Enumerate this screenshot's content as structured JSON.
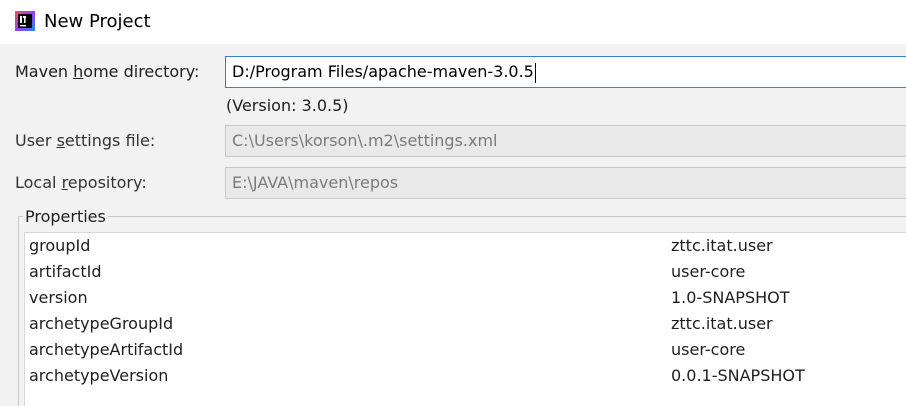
{
  "window": {
    "title": "New Project",
    "icon": "intellij-idea-icon"
  },
  "form": {
    "maven_home": {
      "label_before": "Maven ",
      "label_mnemonic": "h",
      "label_after": "ome directory:",
      "value": "D:/Program Files/apache-maven-3.0.5"
    },
    "version_note": "(Version: 3.0.5)",
    "user_settings": {
      "label_before": "User ",
      "label_mnemonic": "s",
      "label_after": "ettings file:",
      "value": "C:\\Users\\korson\\.m2\\settings.xml"
    },
    "local_repo": {
      "label_before": "Local ",
      "label_mnemonic": "r",
      "label_after": "epository:",
      "value": "E:\\JAVA\\maven\\repos"
    }
  },
  "properties": {
    "legend": "Properties",
    "rows": [
      {
        "key": "groupId",
        "value": "zttc.itat.user"
      },
      {
        "key": "artifactId",
        "value": "user-core"
      },
      {
        "key": "version",
        "value": "1.0-SNAPSHOT"
      },
      {
        "key": "archetypeGroupId",
        "value": "zttc.itat.user"
      },
      {
        "key": "archetypeArtifactId",
        "value": "user-core"
      },
      {
        "key": "archetypeVersion",
        "value": "0.0.1-SNAPSHOT"
      }
    ]
  },
  "colors": {
    "accent": "#3b7cd6",
    "background": "#f2f2f2"
  }
}
